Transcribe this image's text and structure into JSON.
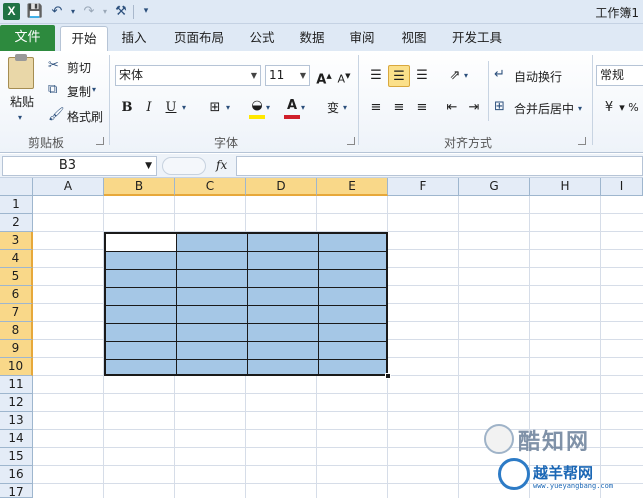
{
  "title": "工作簿1",
  "tabs": [
    {
      "label": "文件"
    },
    {
      "label": "开始"
    },
    {
      "label": "插入"
    },
    {
      "label": "页面布局"
    },
    {
      "label": "公式"
    },
    {
      "label": "数据"
    },
    {
      "label": "审阅"
    },
    {
      "label": "视图"
    },
    {
      "label": "开发工具"
    }
  ],
  "clipboard": {
    "paste": "粘贴",
    "cut": "剪切",
    "copy": "复制",
    "format_painter": "格式刷",
    "label": "剪贴板"
  },
  "font": {
    "name": "宋体",
    "size": "11",
    "bold": "B",
    "italic": "I",
    "underline": "U",
    "label": "字体",
    "font_color": "#d0202b",
    "highlight_color": "#ffe800"
  },
  "alignment": {
    "wrap": "自动换行",
    "merge": "合并后居中",
    "label": "对齐方式"
  },
  "number": {
    "format": "常规"
  },
  "formula_bar": {
    "name_box": "B3",
    "fx": "fx"
  },
  "columns": [
    "A",
    "B",
    "C",
    "D",
    "E",
    "F",
    "G",
    "H",
    "I"
  ],
  "rows": [
    "1",
    "2",
    "3",
    "4",
    "5",
    "6",
    "7",
    "8",
    "9",
    "10",
    "11",
    "12",
    "13",
    "14",
    "15",
    "16",
    "17"
  ],
  "selection": {
    "fill_color": "#a5c7e6",
    "range": "B3:E10"
  },
  "watermark": {
    "brand1": "酷知网",
    "brand2": "越羊帮网",
    "url": "www.yueyangbang.com"
  }
}
